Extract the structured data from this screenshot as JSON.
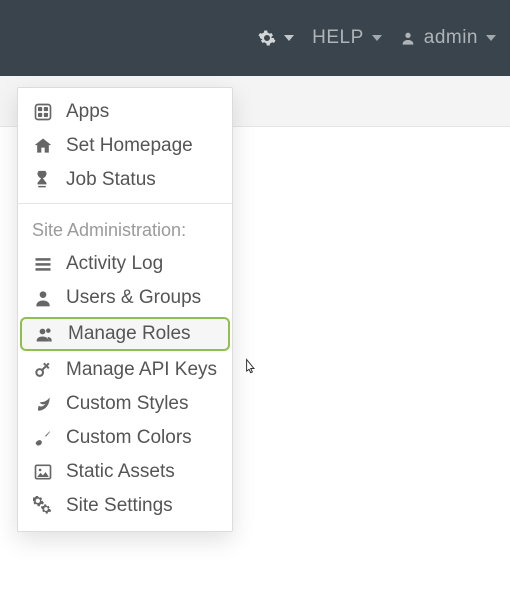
{
  "topbar": {
    "help_label": "HELP",
    "user_label": "admin"
  },
  "menu": {
    "group1": [
      {
        "icon": "apps-icon",
        "label": "Apps"
      },
      {
        "icon": "home-icon",
        "label": "Set Homepage"
      },
      {
        "icon": "hourglass-icon",
        "label": "Job Status"
      }
    ],
    "section_title": "Site Administration:",
    "group2": [
      {
        "icon": "list-icon",
        "label": "Activity Log"
      },
      {
        "icon": "user-icon",
        "label": "Users & Groups"
      },
      {
        "icon": "users-icon",
        "label": "Manage Roles",
        "highlight": true
      },
      {
        "icon": "key-icon",
        "label": "Manage API Keys"
      },
      {
        "icon": "leaf-icon",
        "label": "Custom Styles"
      },
      {
        "icon": "brush-icon",
        "label": "Custom Colors"
      },
      {
        "icon": "image-icon",
        "label": "Static Assets"
      },
      {
        "icon": "gears-icon",
        "label": "Site Settings"
      }
    ]
  }
}
